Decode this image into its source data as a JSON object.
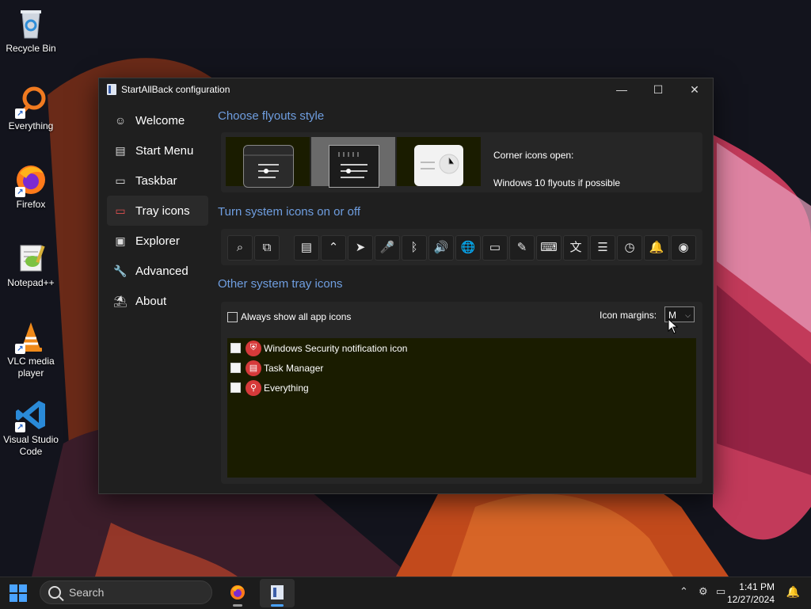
{
  "desktop": {
    "icons": [
      {
        "label": "Recycle Bin",
        "icon": "recycle-bin-icon"
      },
      {
        "label": "Everything",
        "icon": "everything-icon"
      },
      {
        "label": "Firefox",
        "icon": "firefox-icon"
      },
      {
        "label": "Notepad++",
        "icon": "notepad-plus-plus-icon"
      },
      {
        "label": "VLC media player",
        "icon": "vlc-icon"
      },
      {
        "label": "Visual Studio Code",
        "icon": "vscode-icon"
      }
    ]
  },
  "window": {
    "title": "StartAllBack configuration",
    "nav": [
      {
        "label": "Welcome",
        "icon": "smile-icon",
        "active": false
      },
      {
        "label": "Start Menu",
        "icon": "start-menu-icon",
        "active": false
      },
      {
        "label": "Taskbar",
        "icon": "taskbar-icon",
        "active": false
      },
      {
        "label": "Tray icons",
        "icon": "tray-icon",
        "active": true
      },
      {
        "label": "Explorer",
        "icon": "folder-icon",
        "active": false
      },
      {
        "label": "Advanced",
        "icon": "wrench-icon",
        "active": false
      },
      {
        "label": "About",
        "icon": "about-icon",
        "active": false
      }
    ],
    "flyouts": {
      "title": "Choose flyouts style",
      "selected_index": 1,
      "corner_label": "Corner icons open:",
      "corner_value": "Windows 10 flyouts if possible"
    },
    "system_icons": {
      "title": "Turn system icons on or off",
      "icons": [
        "search-icon",
        "task-view-icon",
        "widgets-icon",
        "chevron-up-icon",
        "location-icon",
        "microphone-icon",
        "bluetooth-icon",
        "volume-icon",
        "network-icon",
        "battery-icon",
        "pen-icon",
        "keyboard-icon",
        "language-icon",
        "settings-sliders-icon",
        "clock-icon",
        "bell-icon",
        "eye-icon"
      ]
    },
    "tray": {
      "title": "Other system tray icons",
      "always_show_label": "Always show all app icons",
      "always_show_checked": false,
      "margins_label": "Icon margins:",
      "margins_value": "M",
      "items": [
        {
          "label": "Windows Security notification icon",
          "icon": "security-shield-icon",
          "checked": false
        },
        {
          "label": "Task Manager",
          "icon": "task-manager-icon",
          "checked": false
        },
        {
          "label": "Everything",
          "icon": "everything-icon",
          "checked": false
        }
      ]
    }
  },
  "taskbar": {
    "search_placeholder": "Search",
    "time": "1:41 PM",
    "date": "12/27/2024"
  },
  "colors": {
    "accent": "#4aa3ff",
    "heading": "#6f9ee0",
    "active_nav_icon": "#e05050"
  }
}
